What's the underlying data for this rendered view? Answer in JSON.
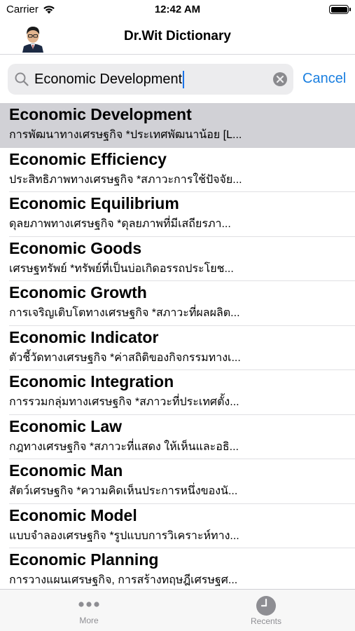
{
  "status_bar": {
    "carrier": "Carrier",
    "time": "12:42 AM"
  },
  "nav": {
    "title": "Dr.Wit Dictionary"
  },
  "search": {
    "value": "Economic Development",
    "cancel_label": "Cancel"
  },
  "results": [
    {
      "title": "Economic Development",
      "subtitle": "การพัฒนาทางเศรษฐกิจ *ประเทศพัฒนาน้อย [L...",
      "selected": true
    },
    {
      "title": "Economic Efficiency",
      "subtitle": "ประสิทธิภาพทางเศรษฐกิจ *สภาวะการใช้ปัจจัย..."
    },
    {
      "title": "Economic Equilibrium",
      "subtitle": "ดุลยภาพทางเศรษฐกิจ *ดุลยภาพที่มีเสถียรภา..."
    },
    {
      "title": "Economic Goods",
      "subtitle": "เศรษฐทรัพย์ *ทรัพย์ที่เป็นบ่อเกิดอรรถประโยช..."
    },
    {
      "title": "Economic Growth",
      "subtitle": "การเจริญเติบโตทางเศรษฐกิจ *สภาวะที่ผลผลิต..."
    },
    {
      "title": "Economic Indicator",
      "subtitle": "ตัวชี้วัดทางเศรษฐกิจ *ค่าสถิติของกิจกรรมทางเ..."
    },
    {
      "title": "Economic Integration",
      "subtitle": "การรวมกลุ่มทางเศรษฐกิจ *สภาวะที่ประเทศตั้ง..."
    },
    {
      "title": "Economic Law",
      "subtitle": "กฎทางเศรษฐกิจ *สภาวะที่แสดง ให้เห็นและอธิ..."
    },
    {
      "title": "Economic Man",
      "subtitle": "สัตว์เศรษฐกิจ *ความคิดเห็นประการหนึ่งของนั..."
    },
    {
      "title": "Economic Model",
      "subtitle": "แบบจำลองเศรษฐกิจ *รูปแบบการวิเคราะห์ทาง..."
    },
    {
      "title": "Economic Planning",
      "subtitle": "การวางแผนเศรษฐกิจ, การสร้างทฤษฎีเศรษฐศ..."
    }
  ],
  "tab_bar": {
    "more_label": "More",
    "recents_label": "Recents"
  },
  "colors": {
    "accent": "#1a7fe0",
    "selected_row": "#d1d1d6",
    "search_bg": "#ececee",
    "tab_inactive": "#8e8e93"
  },
  "icons": [
    "wifi-icon",
    "battery-icon",
    "avatar-photo",
    "search-icon",
    "clear-icon",
    "more-dots-icon",
    "clock-icon"
  ]
}
